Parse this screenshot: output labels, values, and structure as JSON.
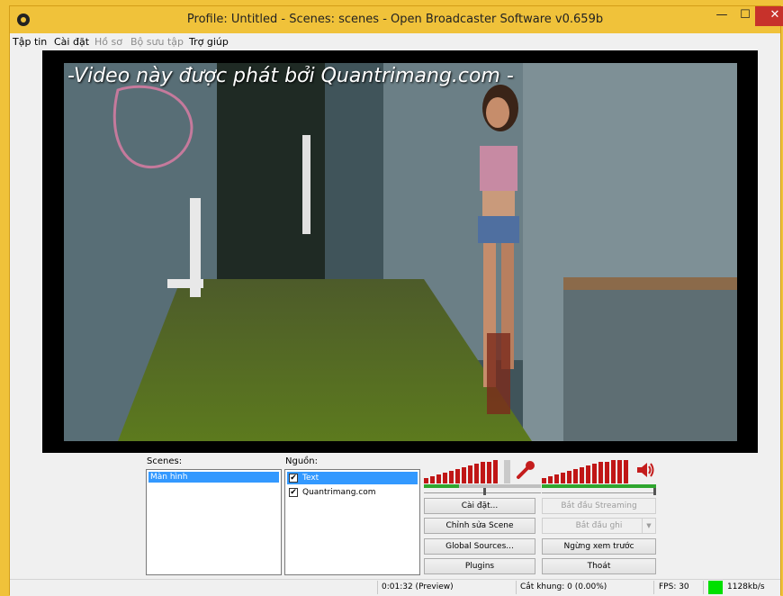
{
  "window": {
    "title": "Profile: Untitled - Scenes: scenes - Open Broadcaster Software v0.659b",
    "controls": {
      "minimize": "—",
      "maximize": "☐",
      "close": "✕"
    }
  },
  "menu": [
    "Tập tin",
    "Cài đặt",
    "Hồ sơ",
    "Bộ sưu tập",
    "Trợ giúp"
  ],
  "preview": {
    "overlay_text": "-Video này được phát bởi Quantrimang.com -"
  },
  "scenes": {
    "label": "Scenes:",
    "items": [
      "Màn hình"
    ]
  },
  "sources": {
    "label": "Nguồn:",
    "items": [
      {
        "name": "Text",
        "checked": "✔"
      },
      {
        "name": "Quantrimang.com",
        "checked": "✔"
      }
    ]
  },
  "audio": {
    "mic_level": 0.3,
    "desktop_level": 1.0,
    "mic_icon": "microphone-icon",
    "speaker_icon": "speaker-icon"
  },
  "buttons": {
    "settings": "Cài đặt...",
    "start_streaming": "Bắt đầu Streaming",
    "edit_scene": "Chỉnh sửa Scene",
    "start_recording": "Bắt đầu ghi",
    "global_sources": "Global Sources...",
    "stop_preview": "Ngừng xem trước",
    "plugins": "Plugins",
    "exit": "Thoát"
  },
  "status": {
    "time": "0:01:32 (Preview)",
    "dropped": "Cắt khung: 0 (0.00%)",
    "fps": "FPS: 30",
    "bitrate": "1128kb/s",
    "bitrate_color": "#00e000"
  }
}
